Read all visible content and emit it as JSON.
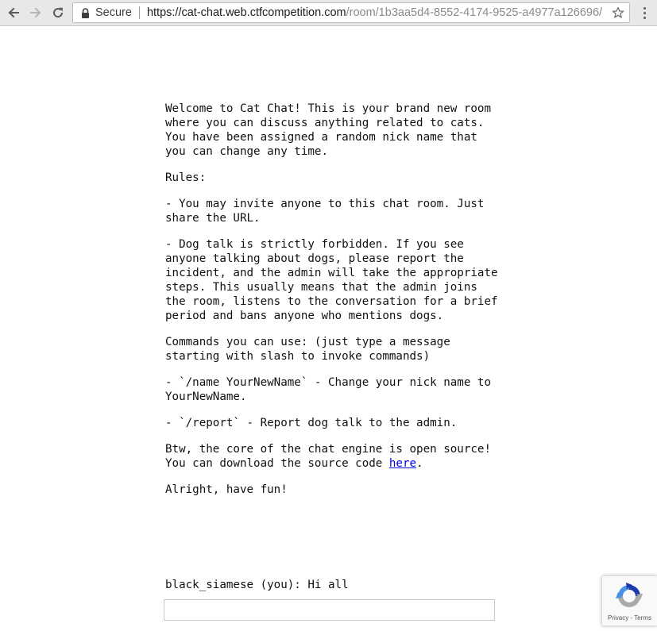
{
  "browser": {
    "security_label": "Secure",
    "url_host": "https://cat-chat.web.ctfcompetition.com",
    "url_path": "/room/1b3aa5d4-8552-4174-9525-a4977a126696/",
    "icons": {
      "back": "arrow-left-icon",
      "forward": "arrow-right-icon",
      "reload": "reload-icon",
      "lock": "lock-icon",
      "bookmark": "star-icon",
      "menu": "kebab-menu-icon"
    }
  },
  "page": {
    "intro": "Welcome to Cat Chat! This is your brand new room where you can discuss anything related to cats. You have been assigned a random nick name that you can change any time.",
    "rules_heading": "Rules:",
    "rule_invite": "- You may invite anyone to this chat room. Just share the URL.",
    "rule_dogs": "- Dog talk is strictly forbidden. If you see anyone talking about dogs, please report the incident, and the admin will take the appropriate steps. This usually means that the admin joins the room, listens to the conversation for a brief period and bans anyone who mentions dogs.",
    "commands_heading": "Commands you can use: (just type a message starting with slash to invoke commands)",
    "command_name": "- `/name YourNewName` - Change your nick name to YourNewName.",
    "command_report": "- `/report` - Report dog talk to the admin.",
    "source_text_before": "Btw, the core of the chat engine is open source! You can download the source code ",
    "source_link": "here",
    "source_text_after": ".",
    "closing": "Alright, have fun!"
  },
  "chat": {
    "messages": [
      {
        "text": "black_siamese (you): Hi all"
      }
    ],
    "input_value": "",
    "input_placeholder": ""
  },
  "recaptcha": {
    "privacy_label": "Privacy",
    "separator": " - ",
    "terms_label": "Terms",
    "colors": {
      "blue": "#1c3aa9",
      "light_blue": "#4a90e2",
      "gray": "#aaaaaa"
    }
  }
}
